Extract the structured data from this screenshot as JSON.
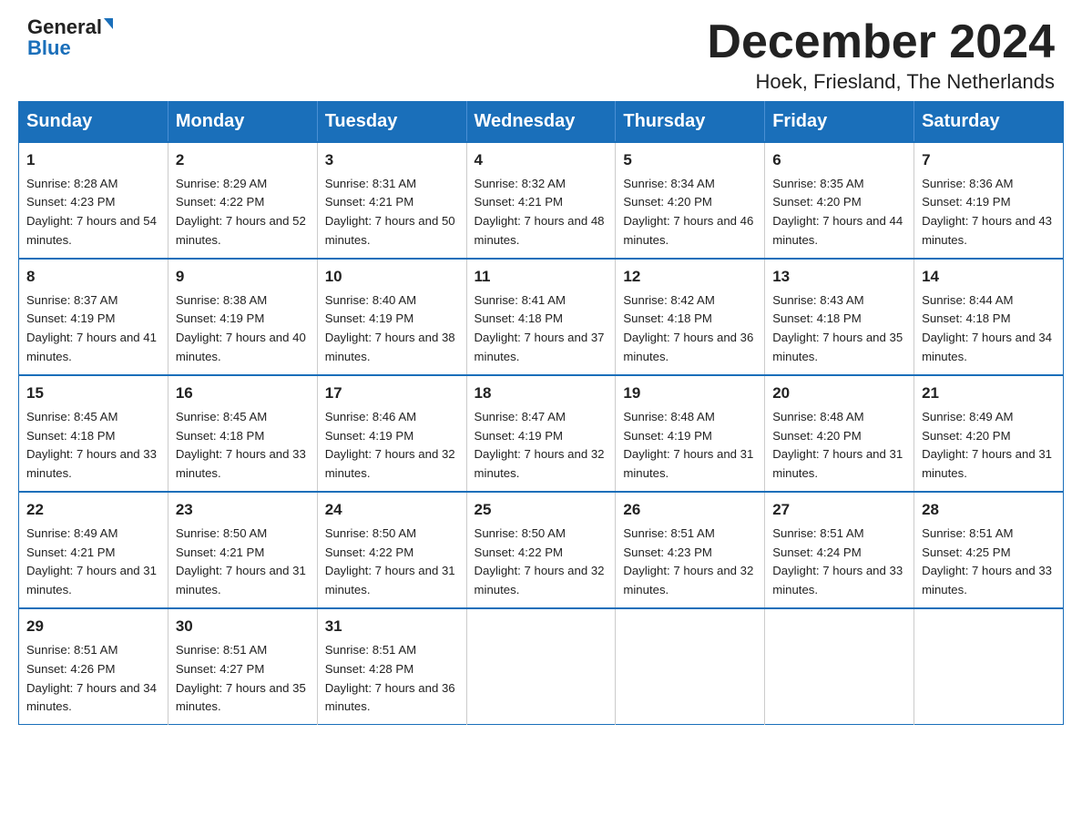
{
  "header": {
    "logo_line1": "General",
    "logo_line2": "Blue",
    "month_title": "December 2024",
    "subtitle": "Hoek, Friesland, The Netherlands"
  },
  "days_of_week": [
    "Sunday",
    "Monday",
    "Tuesday",
    "Wednesday",
    "Thursday",
    "Friday",
    "Saturday"
  ],
  "weeks": [
    [
      {
        "day": "1",
        "sunrise": "8:28 AM",
        "sunset": "4:23 PM",
        "daylight": "7 hours and 54 minutes."
      },
      {
        "day": "2",
        "sunrise": "8:29 AM",
        "sunset": "4:22 PM",
        "daylight": "7 hours and 52 minutes."
      },
      {
        "day": "3",
        "sunrise": "8:31 AM",
        "sunset": "4:21 PM",
        "daylight": "7 hours and 50 minutes."
      },
      {
        "day": "4",
        "sunrise": "8:32 AM",
        "sunset": "4:21 PM",
        "daylight": "7 hours and 48 minutes."
      },
      {
        "day": "5",
        "sunrise": "8:34 AM",
        "sunset": "4:20 PM",
        "daylight": "7 hours and 46 minutes."
      },
      {
        "day": "6",
        "sunrise": "8:35 AM",
        "sunset": "4:20 PM",
        "daylight": "7 hours and 44 minutes."
      },
      {
        "day": "7",
        "sunrise": "8:36 AM",
        "sunset": "4:19 PM",
        "daylight": "7 hours and 43 minutes."
      }
    ],
    [
      {
        "day": "8",
        "sunrise": "8:37 AM",
        "sunset": "4:19 PM",
        "daylight": "7 hours and 41 minutes."
      },
      {
        "day": "9",
        "sunrise": "8:38 AM",
        "sunset": "4:19 PM",
        "daylight": "7 hours and 40 minutes."
      },
      {
        "day": "10",
        "sunrise": "8:40 AM",
        "sunset": "4:19 PM",
        "daylight": "7 hours and 38 minutes."
      },
      {
        "day": "11",
        "sunrise": "8:41 AM",
        "sunset": "4:18 PM",
        "daylight": "7 hours and 37 minutes."
      },
      {
        "day": "12",
        "sunrise": "8:42 AM",
        "sunset": "4:18 PM",
        "daylight": "7 hours and 36 minutes."
      },
      {
        "day": "13",
        "sunrise": "8:43 AM",
        "sunset": "4:18 PM",
        "daylight": "7 hours and 35 minutes."
      },
      {
        "day": "14",
        "sunrise": "8:44 AM",
        "sunset": "4:18 PM",
        "daylight": "7 hours and 34 minutes."
      }
    ],
    [
      {
        "day": "15",
        "sunrise": "8:45 AM",
        "sunset": "4:18 PM",
        "daylight": "7 hours and 33 minutes."
      },
      {
        "day": "16",
        "sunrise": "8:45 AM",
        "sunset": "4:18 PM",
        "daylight": "7 hours and 33 minutes."
      },
      {
        "day": "17",
        "sunrise": "8:46 AM",
        "sunset": "4:19 PM",
        "daylight": "7 hours and 32 minutes."
      },
      {
        "day": "18",
        "sunrise": "8:47 AM",
        "sunset": "4:19 PM",
        "daylight": "7 hours and 32 minutes."
      },
      {
        "day": "19",
        "sunrise": "8:48 AM",
        "sunset": "4:19 PM",
        "daylight": "7 hours and 31 minutes."
      },
      {
        "day": "20",
        "sunrise": "8:48 AM",
        "sunset": "4:20 PM",
        "daylight": "7 hours and 31 minutes."
      },
      {
        "day": "21",
        "sunrise": "8:49 AM",
        "sunset": "4:20 PM",
        "daylight": "7 hours and 31 minutes."
      }
    ],
    [
      {
        "day": "22",
        "sunrise": "8:49 AM",
        "sunset": "4:21 PM",
        "daylight": "7 hours and 31 minutes."
      },
      {
        "day": "23",
        "sunrise": "8:50 AM",
        "sunset": "4:21 PM",
        "daylight": "7 hours and 31 minutes."
      },
      {
        "day": "24",
        "sunrise": "8:50 AM",
        "sunset": "4:22 PM",
        "daylight": "7 hours and 31 minutes."
      },
      {
        "day": "25",
        "sunrise": "8:50 AM",
        "sunset": "4:22 PM",
        "daylight": "7 hours and 32 minutes."
      },
      {
        "day": "26",
        "sunrise": "8:51 AM",
        "sunset": "4:23 PM",
        "daylight": "7 hours and 32 minutes."
      },
      {
        "day": "27",
        "sunrise": "8:51 AM",
        "sunset": "4:24 PM",
        "daylight": "7 hours and 33 minutes."
      },
      {
        "day": "28",
        "sunrise": "8:51 AM",
        "sunset": "4:25 PM",
        "daylight": "7 hours and 33 minutes."
      }
    ],
    [
      {
        "day": "29",
        "sunrise": "8:51 AM",
        "sunset": "4:26 PM",
        "daylight": "7 hours and 34 minutes."
      },
      {
        "day": "30",
        "sunrise": "8:51 AM",
        "sunset": "4:27 PM",
        "daylight": "7 hours and 35 minutes."
      },
      {
        "day": "31",
        "sunrise": "8:51 AM",
        "sunset": "4:28 PM",
        "daylight": "7 hours and 36 minutes."
      },
      null,
      null,
      null,
      null
    ]
  ]
}
